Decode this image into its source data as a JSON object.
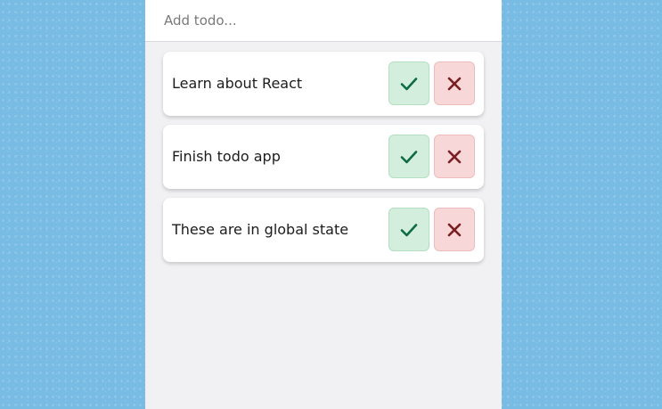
{
  "input": {
    "placeholder": "Add todo...",
    "value": ""
  },
  "todos": [
    {
      "text": "Learn about React"
    },
    {
      "text": "Finish todo app"
    },
    {
      "text": "These are in global state"
    }
  ],
  "icons": {
    "done": "check-icon",
    "delete": "close-icon"
  },
  "colors": {
    "page_background": "#78bce4",
    "panel_background": "#f1f1f3",
    "card_background": "#ffffff",
    "done_button_bg": "#d3eedc",
    "done_icon": "#0f6b45",
    "delete_button_bg": "#f8d7d8",
    "delete_icon": "#7a1f22"
  }
}
